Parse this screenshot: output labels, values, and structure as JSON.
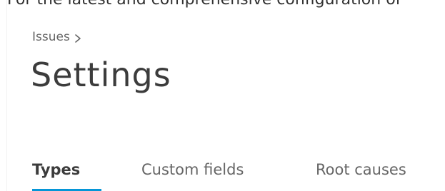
{
  "header": {
    "cutoff_text": "For the latest and comprehensive configuration of the Issues"
  },
  "breadcrumb": {
    "parent_label": "Issues",
    "separator_icon": "chevron-right-icon"
  },
  "page": {
    "title": "Settings"
  },
  "tabs": [
    {
      "label": "Types",
      "active": true
    },
    {
      "label": "Custom fields",
      "active": false
    },
    {
      "label": "Root causes",
      "active": false
    }
  ],
  "colors": {
    "accent": "#0696d7",
    "text_primary": "#3c3c3c",
    "text_secondary": "#666666"
  }
}
